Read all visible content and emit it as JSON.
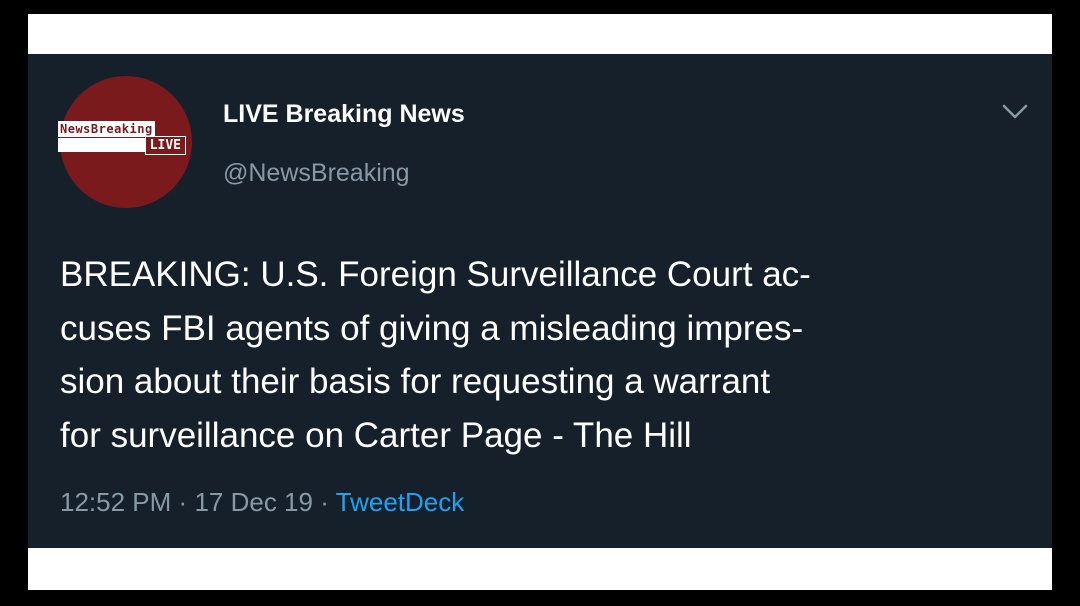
{
  "account": {
    "display_name": "LIVE Breaking News",
    "handle": "@NewsBreaking",
    "avatar_logo_top": "NewsBreaking",
    "avatar_logo_bottom": "LIVE"
  },
  "tweet": {
    "lines": [
      "BREAKING: U.S. Foreign Surveillance Court ac-",
      "cuses FBI agents of giving a misleading impres-",
      "sion about their basis for requesting a warrant",
      "for surveillance on Carter Page - The Hill"
    ]
  },
  "meta": {
    "time": "12:52 PM",
    "separator": "·",
    "date": "17 Dec 19",
    "source": "TweetDeck"
  },
  "icons": {
    "menu": "chevron-down-icon"
  },
  "colors": {
    "background": "#15202b",
    "secondary_text": "#8899a6",
    "link": "#1da1f2",
    "avatar": "#7a1a1c"
  }
}
